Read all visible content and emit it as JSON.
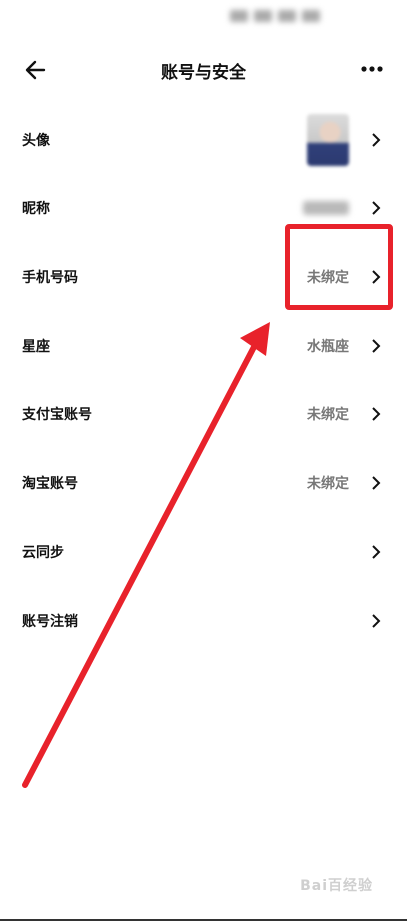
{
  "header": {
    "title": "账号与安全"
  },
  "rows": [
    {
      "label": "头像",
      "value": ""
    },
    {
      "label": "昵称",
      "value": ""
    },
    {
      "label": "手机号码",
      "value": "未绑定"
    },
    {
      "label": "星座",
      "value": "水瓶座"
    },
    {
      "label": "支付宝账号",
      "value": "未绑定"
    },
    {
      "label": "淘宝账号",
      "value": "未绑定"
    },
    {
      "label": "云同步",
      "value": ""
    },
    {
      "label": "账号注销",
      "value": ""
    }
  ],
  "icons": {
    "back": "back-arrow-icon",
    "more": "more-dots-icon",
    "chevron": "chevron-right-icon"
  },
  "colors": {
    "annotation": "#e8222b",
    "value_text": "#777777"
  },
  "watermark": "Bai百经验"
}
